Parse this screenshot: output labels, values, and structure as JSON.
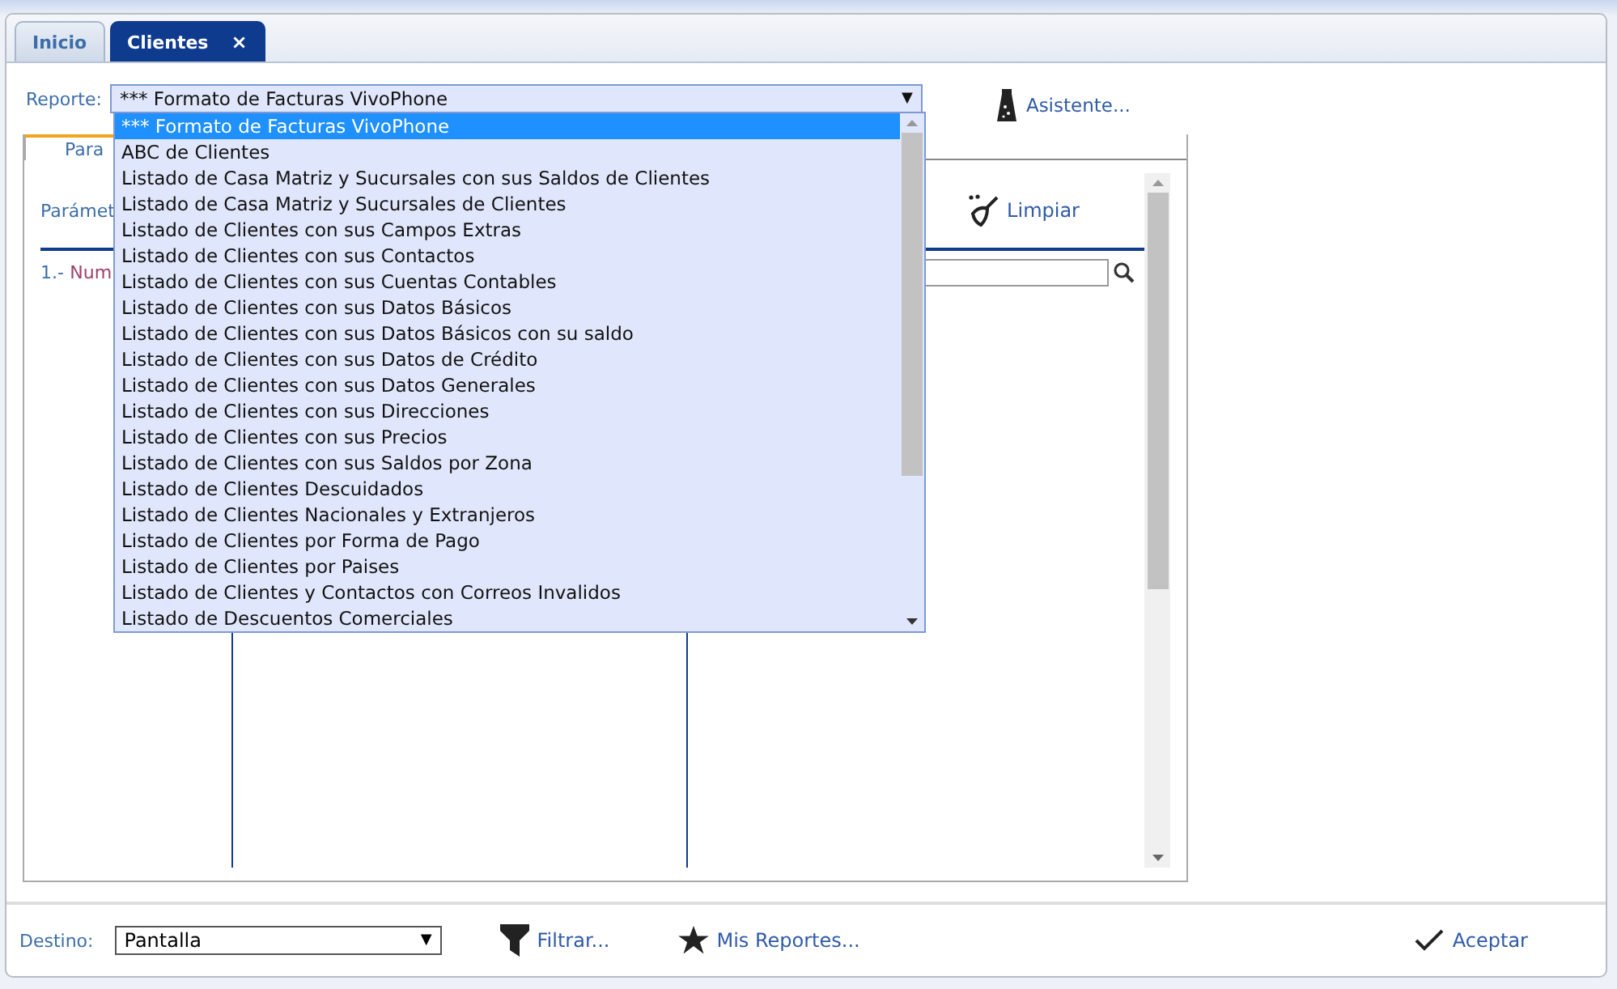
{
  "tabs": [
    {
      "label": "Inicio",
      "selected": false
    },
    {
      "label": "Clientes",
      "selected": true,
      "close": "×"
    }
  ],
  "report": {
    "label": "Reporte:",
    "value": "*** Formato de Facturas VivoPhone",
    "arrow": "▼",
    "expanded": true,
    "options": [
      {
        "label": "*** Formato de Facturas VivoPhone",
        "selected": true
      },
      {
        "label": "ABC de Clientes",
        "selected": false
      },
      {
        "label": "Listado de Casa Matriz y Sucursales con sus Saldos de Clientes",
        "selected": false
      },
      {
        "label": "Listado de Casa Matriz y Sucursales de Clientes",
        "selected": false
      },
      {
        "label": "Listado de Clientes con sus Campos Extras",
        "selected": false
      },
      {
        "label": "Listado de Clientes con sus Contactos",
        "selected": false
      },
      {
        "label": "Listado de Clientes con sus Cuentas Contables",
        "selected": false
      },
      {
        "label": "Listado de Clientes con sus Datos Básicos",
        "selected": false
      },
      {
        "label": "Listado de Clientes con sus Datos Básicos con su saldo",
        "selected": false
      },
      {
        "label": "Listado de Clientes con sus Datos de Crédito",
        "selected": false
      },
      {
        "label": "Listado de Clientes con sus Datos Generales",
        "selected": false
      },
      {
        "label": "Listado de Clientes con sus Direcciones",
        "selected": false
      },
      {
        "label": "Listado de Clientes con sus Precios",
        "selected": false
      },
      {
        "label": "Listado de Clientes con sus Saldos por Zona",
        "selected": false
      },
      {
        "label": "Listado de Clientes Descuidados",
        "selected": false
      },
      {
        "label": "Listado de Clientes Nacionales y Extranjeros",
        "selected": false
      },
      {
        "label": "Listado de Clientes por Forma de Pago",
        "selected": false
      },
      {
        "label": "Listado de Clientes por Paises",
        "selected": false
      },
      {
        "label": "Listado de Clientes y Contactos con Correos Invalidos",
        "selected": false
      },
      {
        "label": "Listado de Descuentos Comerciales",
        "selected": false
      }
    ]
  },
  "assistant": "Asistente...",
  "panel": {
    "tab": "Para",
    "heading": "Parámet",
    "clear": "Limpiar",
    "param_index": "1.-",
    "param_name": "Num"
  },
  "footer": {
    "destination_label": "Destino:",
    "destination_value": "Pantalla",
    "destination_arrow": "▼",
    "filter": "Filtrar...",
    "my_reports": "Mis Reportes...",
    "accept": "Aceptar"
  }
}
